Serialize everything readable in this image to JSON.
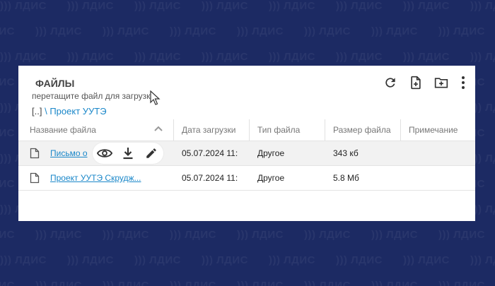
{
  "panel": {
    "title": "ФАЙЛЫ",
    "subtitle": "перетащите файл для загрузки.",
    "breadcrumb": {
      "root": "[..]",
      "separator": "\\",
      "current": "Проект УУТЭ"
    }
  },
  "toolbar": {
    "items": [
      {
        "icon": "refresh-icon"
      },
      {
        "icon": "add-file-icon"
      },
      {
        "icon": "add-folder-icon"
      },
      {
        "icon": "more-vert-icon"
      }
    ]
  },
  "table": {
    "columns": [
      "Название файла",
      "Дата загрузки",
      "Тип файла",
      "Размер файла",
      "Примечание"
    ],
    "rows": [
      {
        "name": "Письмо о",
        "date": "05.07.2024 11:",
        "type": "Другое",
        "size": "343 кб",
        "note": ""
      },
      {
        "name": "Проект УУТЭ Скрудж...",
        "date": "05.07.2024 11:",
        "type": "Другое",
        "size": "5.8 Мб",
        "note": ""
      }
    ]
  },
  "hover_actions": [
    "view-icon",
    "download-icon",
    "edit-icon"
  ],
  "colors": {
    "accent": "#1a87c9",
    "background": "#1c2a63",
    "icon": "#333333"
  },
  "watermark": "ЛДИС"
}
